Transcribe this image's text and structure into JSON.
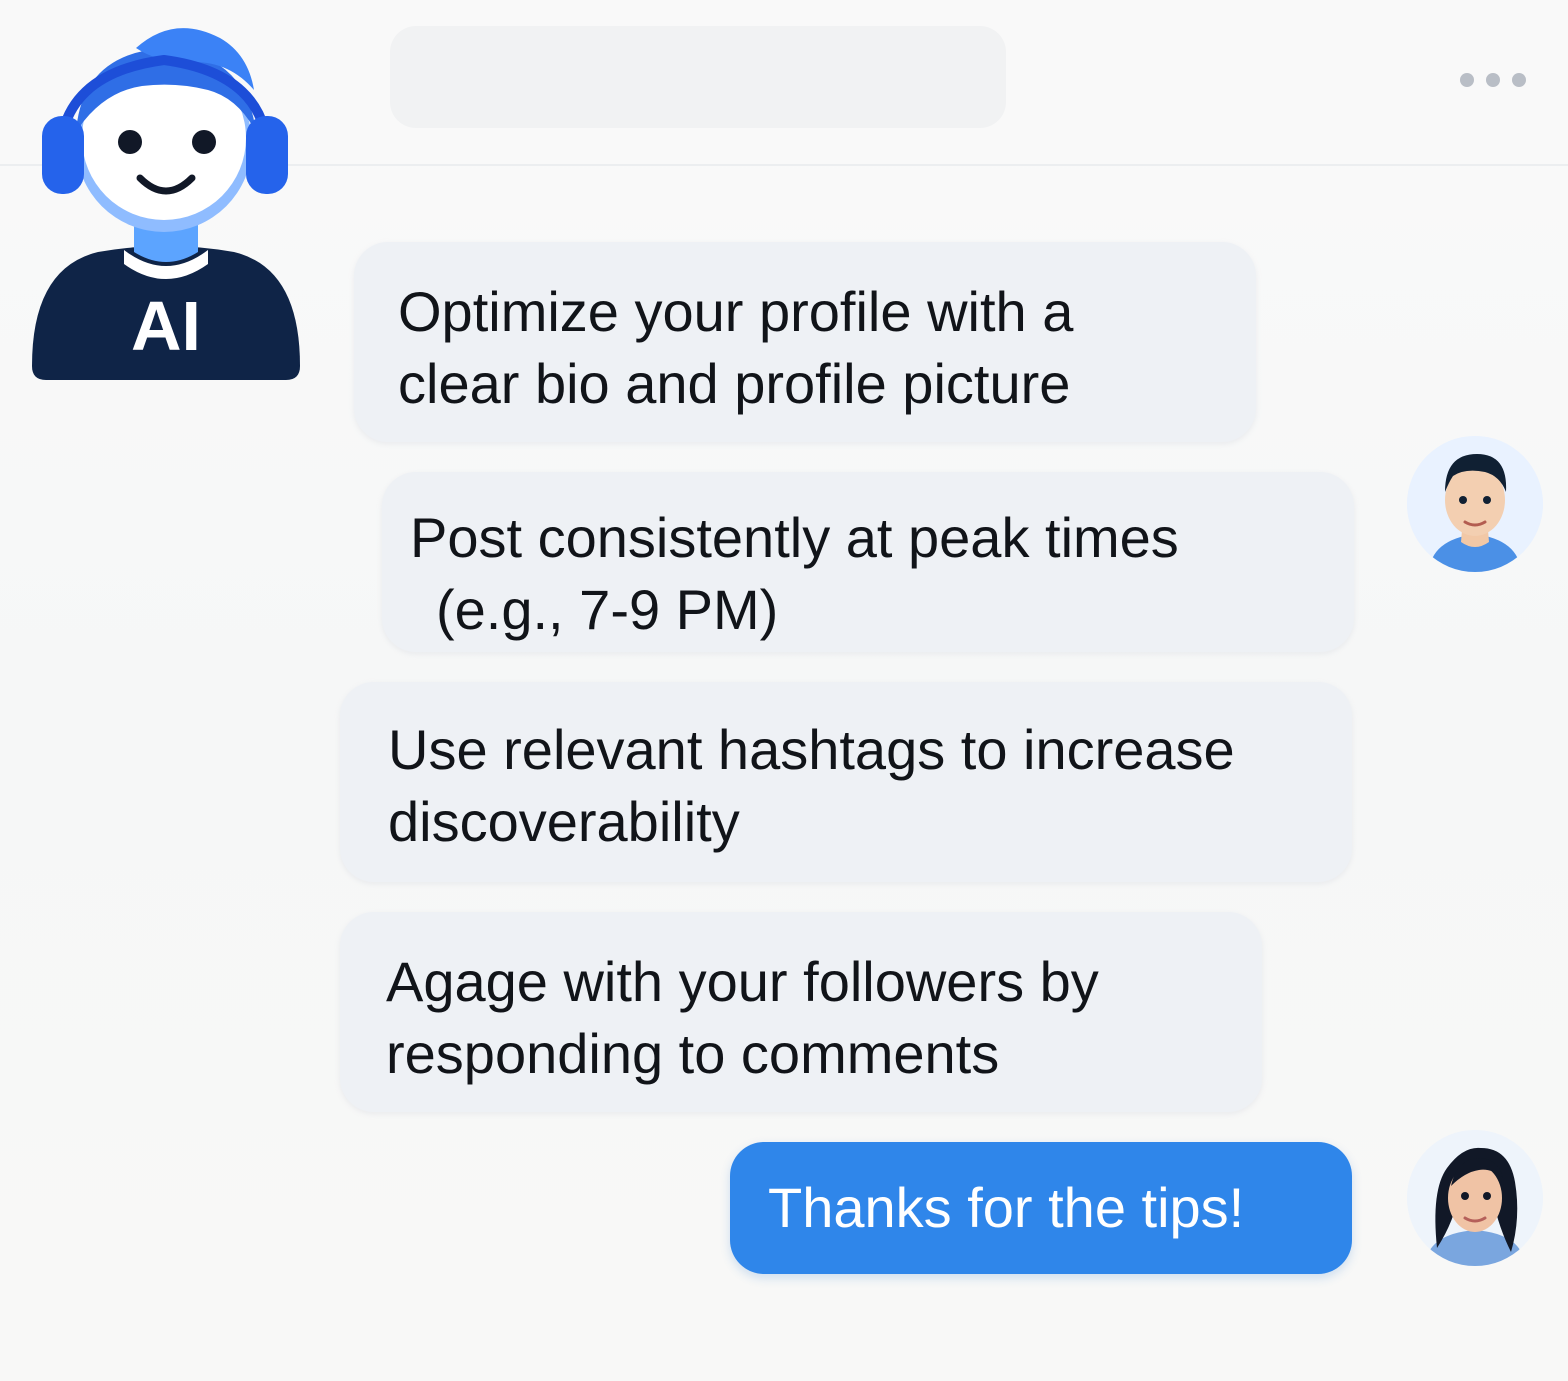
{
  "header": {
    "title": "",
    "more_icon": "more-horizontal-icon"
  },
  "ai_avatar": {
    "label": "AI",
    "icon": "headset-bot-avatar"
  },
  "messages": [
    {
      "sender": "ai",
      "lines": [
        "Optimize your profile with a",
        "clear bio and profile picture"
      ]
    },
    {
      "sender": "ai",
      "lines": [
        "Post consistently at peak times",
        "(e.g., 7-9 PM)"
      ]
    },
    {
      "sender": "ai",
      "lines": [
        "Use relevant hashtags to increase",
        "discoverability"
      ]
    },
    {
      "sender": "ai",
      "lines": [
        "Agage with your followers by",
        "responding to comments"
      ]
    },
    {
      "sender": "user",
      "lines": [
        "Thanks for the tips!"
      ]
    }
  ],
  "colors": {
    "background": "#f8f8f8",
    "bubble": "#eef1f5",
    "accent": "#2f86ea",
    "ai_avatar_blue": "#2f6ee6",
    "ai_shirt": "#0f2447"
  }
}
